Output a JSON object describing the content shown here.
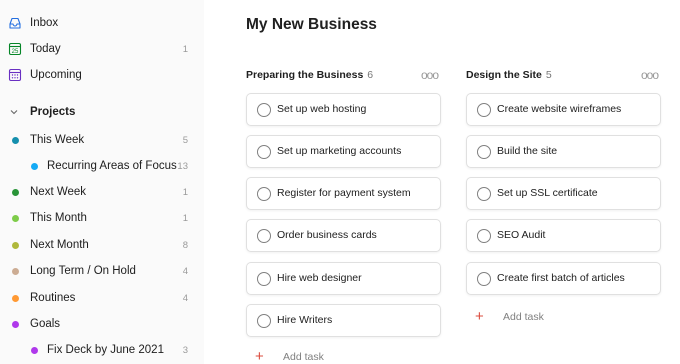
{
  "sidebar": {
    "nav": [
      {
        "label": "Inbox",
        "count": "",
        "icon": "inbox-icon"
      },
      {
        "label": "Today",
        "count": "1",
        "icon": "calendar-today-icon"
      },
      {
        "label": "Upcoming",
        "count": "",
        "icon": "calendar-upcoming-icon"
      }
    ],
    "projects_header": "Projects",
    "projects": [
      {
        "label": "This Week",
        "count": "5",
        "color": "#158fad"
      },
      {
        "label": "Recurring Areas of Focus",
        "count": "13",
        "color": "#14aaf5"
      },
      {
        "label": "Next Week",
        "count": "1",
        "color": "#299438"
      },
      {
        "label": "This Month",
        "count": "1",
        "color": "#7ecc49"
      },
      {
        "label": "Next Month",
        "count": "8",
        "color": "#afb83b"
      },
      {
        "label": "Long Term / On Hold",
        "count": "4",
        "color": "#ccac93"
      },
      {
        "label": "Routines",
        "count": "4",
        "color": "#ff9933"
      },
      {
        "label": "Goals",
        "count": "",
        "color": "#af38eb"
      },
      {
        "label": "Fix Deck by June 2021",
        "count": "3",
        "color": "#af38eb"
      }
    ]
  },
  "main": {
    "title": "My New Business",
    "sections": [
      {
        "name": "Preparing the Business",
        "count": "6",
        "tasks": [
          "Set up web hosting",
          "Set up marketing accounts",
          "Register for payment system",
          "Order business cards",
          "Hire web designer",
          "Hire Writers"
        ],
        "add_label": "Add task"
      },
      {
        "name": "Design the Site",
        "count": "5",
        "tasks": [
          "Create website wireframes",
          "Build the site",
          "Set up SSL certificate",
          "SEO Audit",
          "Create first batch of articles"
        ],
        "add_label": "Add task"
      }
    ],
    "menu_glyph": "ooo",
    "add_glyph": "+"
  },
  "colors": {
    "accent": "#db4c3f",
    "sidebar_bg": "#fafafa",
    "nav_icon": "#246fe0"
  }
}
